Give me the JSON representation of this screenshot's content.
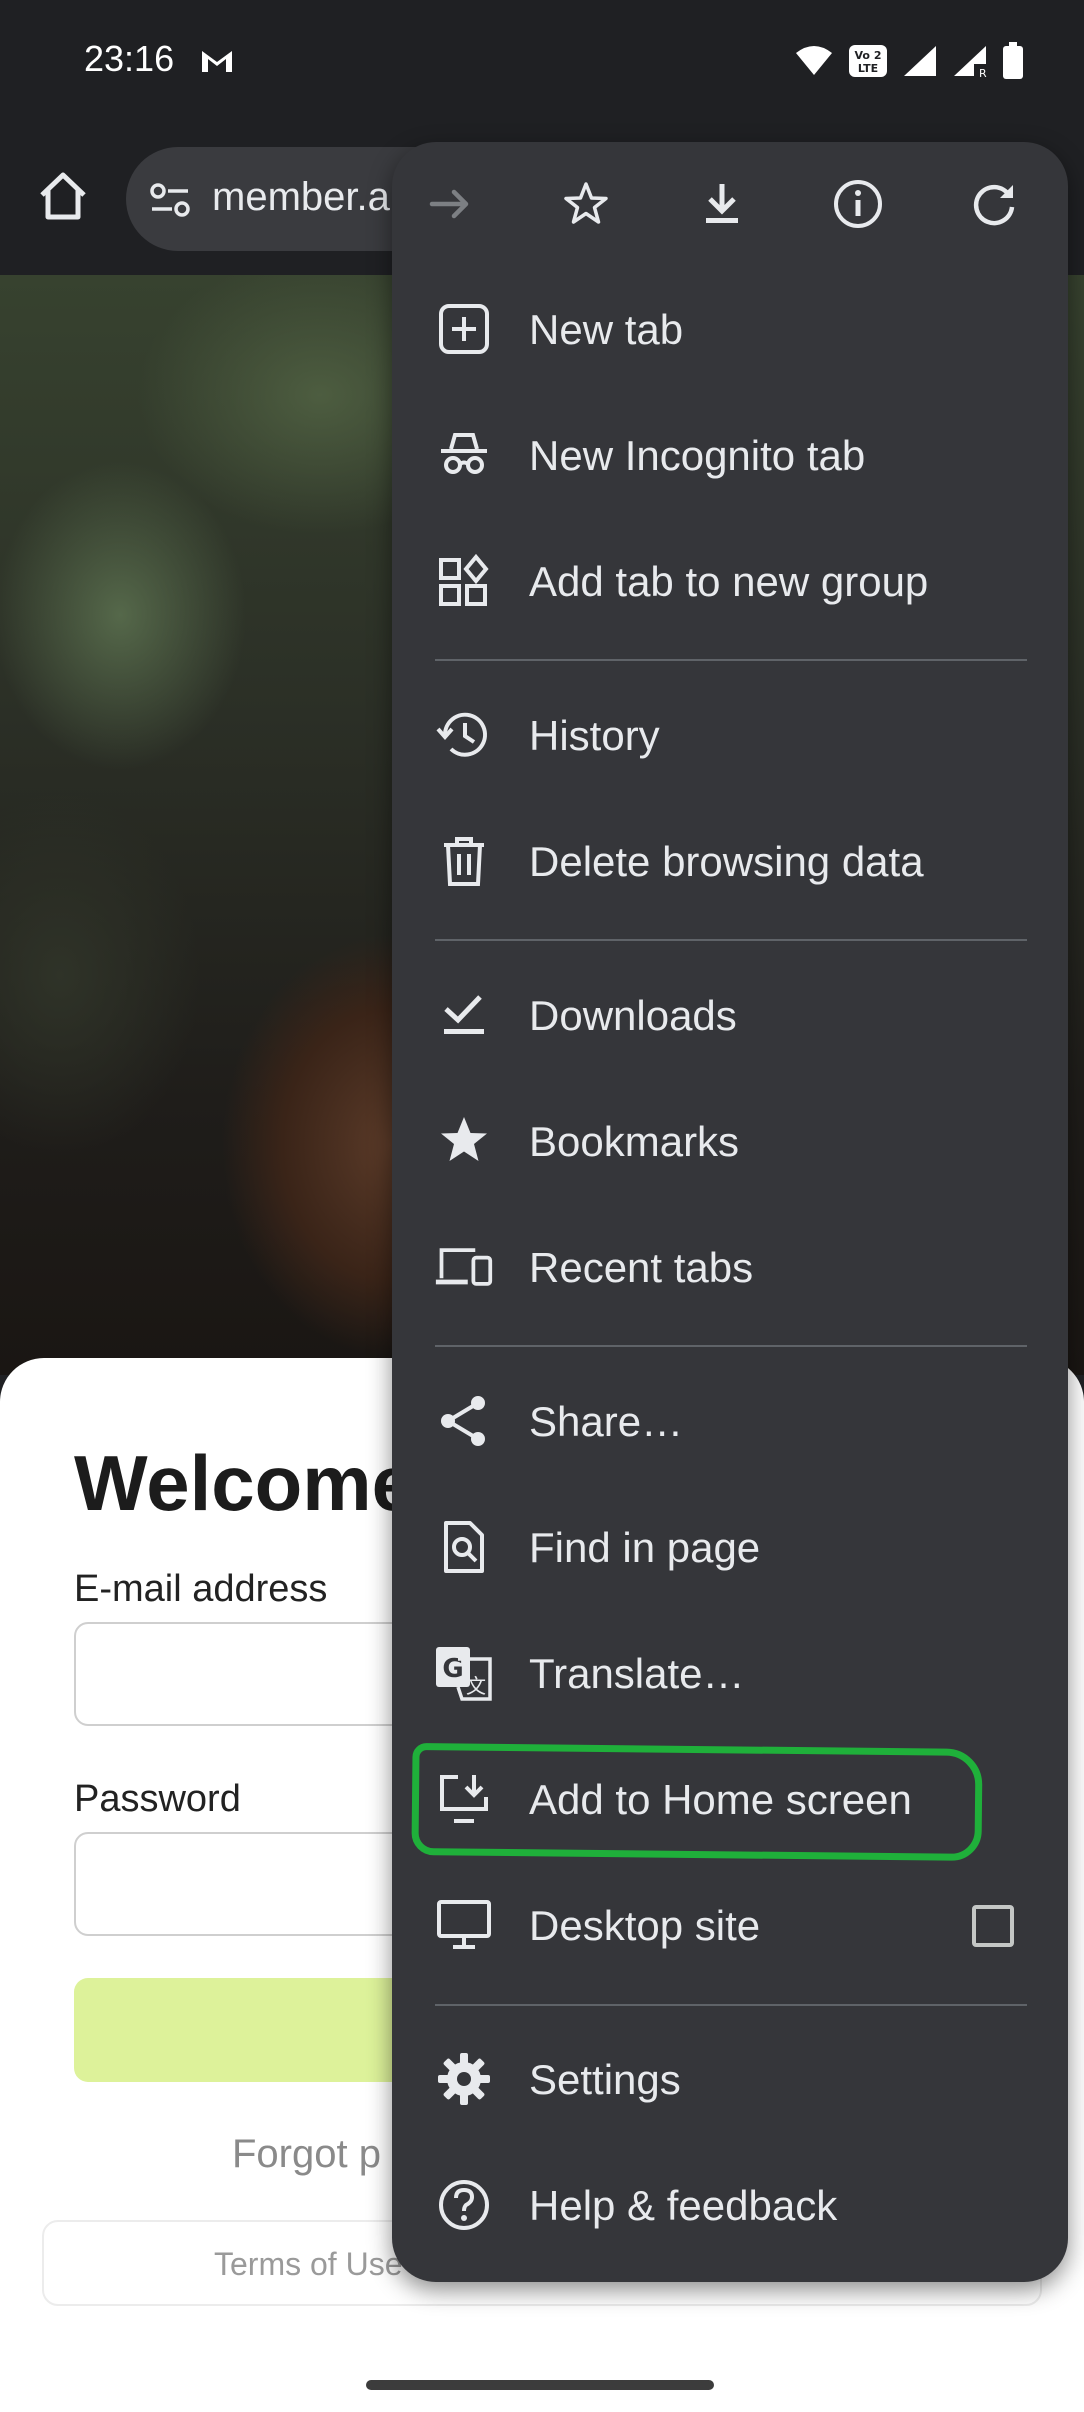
{
  "status_bar": {
    "time": "23:16",
    "icons": [
      "gmail-icon",
      "wifi-icon",
      "volte-icon",
      "signal-icon",
      "signal-roaming-icon",
      "battery-icon"
    ]
  },
  "toolbar": {
    "url": "member.a",
    "icons": [
      "home-icon",
      "site-info-icon"
    ]
  },
  "page": {
    "welcome": "Welcome",
    "email_label": "E-mail address",
    "password_label": "Password",
    "forgot": "Forgot p",
    "terms": "Terms of Use",
    "login_button_color": "#ddf29a"
  },
  "menu": {
    "top_icons": [
      "forward-icon",
      "bookmark-star-icon",
      "download-icon",
      "info-icon",
      "reload-icon"
    ],
    "items": [
      {
        "label": "New tab",
        "icon": "new-tab-icon"
      },
      {
        "label": "New Incognito tab",
        "icon": "incognito-icon"
      },
      {
        "label": "Add tab to new group",
        "icon": "tab-group-icon"
      },
      {
        "label": "History",
        "icon": "history-icon"
      },
      {
        "label": "Delete browsing data",
        "icon": "trash-icon"
      },
      {
        "label": "Downloads",
        "icon": "downloads-icon"
      },
      {
        "label": "Bookmarks",
        "icon": "bookmarks-star-icon"
      },
      {
        "label": "Recent tabs",
        "icon": "devices-icon"
      },
      {
        "label": "Share…",
        "icon": "share-icon"
      },
      {
        "label": "Find in page",
        "icon": "find-in-page-icon"
      },
      {
        "label": "Translate…",
        "icon": "translate-icon"
      },
      {
        "label": "Add to Home screen",
        "icon": "add-to-home-icon"
      },
      {
        "label": "Desktop site",
        "icon": "desktop-icon",
        "checked": false
      },
      {
        "label": "Settings",
        "icon": "settings-gear-icon"
      },
      {
        "label": "Help & feedback",
        "icon": "help-icon"
      }
    ],
    "highlight_color": "#1fb03a"
  }
}
